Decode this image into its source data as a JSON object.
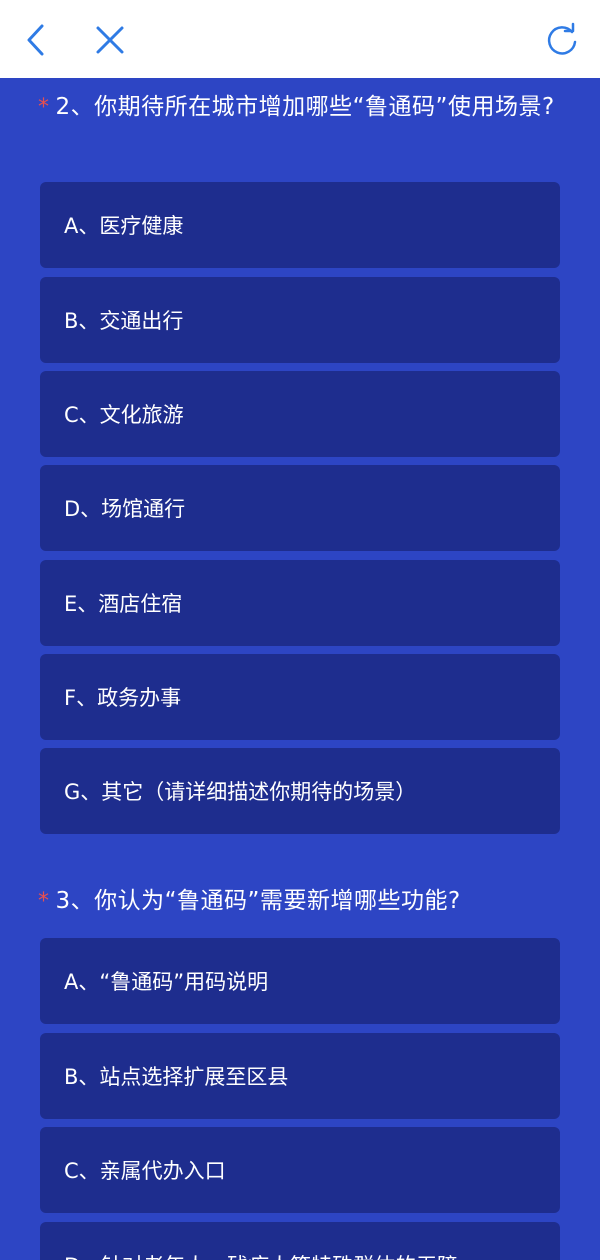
{
  "colors": {
    "background": "#2d45c4",
    "option_bg": "#1e2d8e",
    "required": "#e8504f",
    "icon": "#2f7be5",
    "topbar": "#ffffff"
  },
  "topbar": {
    "back_icon": "chevron-left-icon",
    "close_icon": "close-icon",
    "refresh_icon": "refresh-icon"
  },
  "questions": [
    {
      "required_mark": "*",
      "title": "2、你期待所在城市增加哪些“鲁通码”使用场景?",
      "options": [
        "A、医疗健康",
        "B、交通出行",
        "C、文化旅游",
        "D、场馆通行",
        "E、酒店住宿",
        "F、政务办事",
        "G、其它（请详细描述你期待的场景）"
      ]
    },
    {
      "required_mark": "*",
      "title": "3、你认为“鲁通码”需要新增哪些功能?",
      "options": [
        "A、“鲁通码”用码说明",
        "B、站点选择扩展至区县",
        "C、亲属代办入口",
        "D、针对老年人、残疾人等特殊群体的无障"
      ]
    }
  ]
}
